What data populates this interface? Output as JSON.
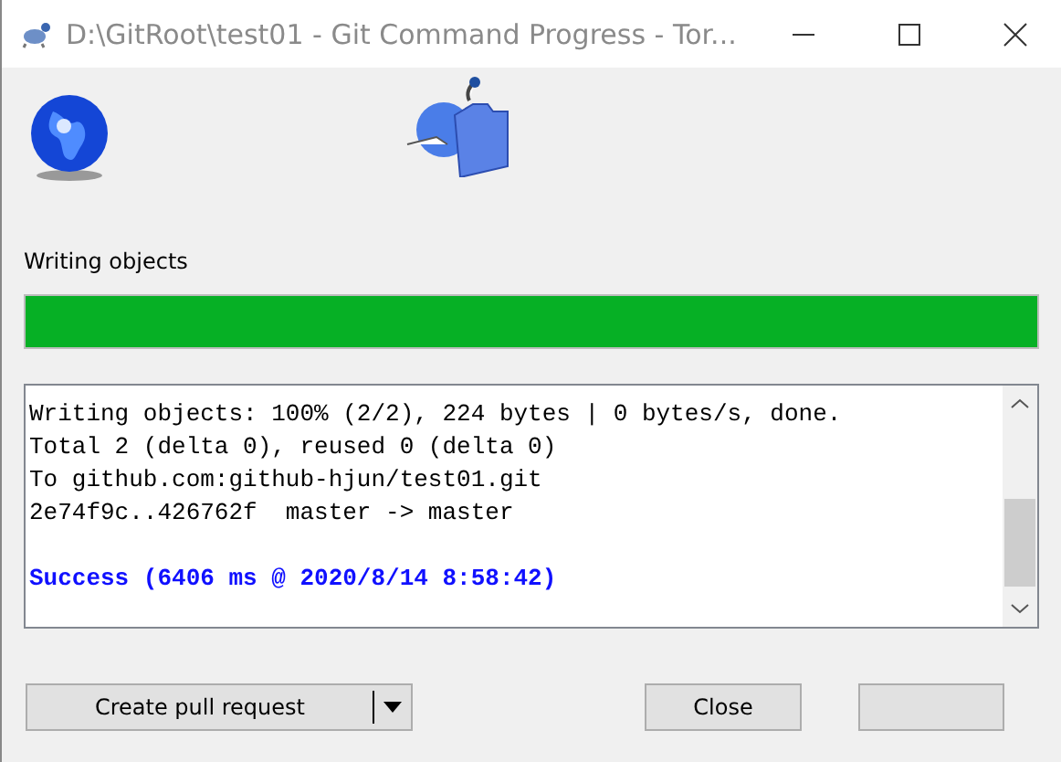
{
  "window": {
    "title": "D:\\GitRoot\\test01 - Git Command Progress - Tor..."
  },
  "status": {
    "label": "Writing objects"
  },
  "progress": {
    "level": 1
  },
  "log": [
    {
      "kind": "normal",
      "text": "Writing objects: 100% (2/2), 224 bytes | 0 bytes/s, done."
    },
    {
      "kind": "normal",
      "text": "Total 2 (delta 0), reused 0 (delta 0)"
    },
    {
      "kind": "normal",
      "text": "To github.com:github-hjun/test01.git"
    },
    {
      "kind": "normal",
      "text": "2e74f9c..426762f  master -> master"
    },
    {
      "kind": "success",
      "text": "Success (6406 ms @ 2020/8/14 8:58:42)"
    }
  ],
  "buttons": [
    {
      "kind": "split",
      "label": "Create pull request"
    },
    {
      "kind": "plain",
      "label": "Close"
    },
    {
      "kind": "blank"
    }
  ]
}
